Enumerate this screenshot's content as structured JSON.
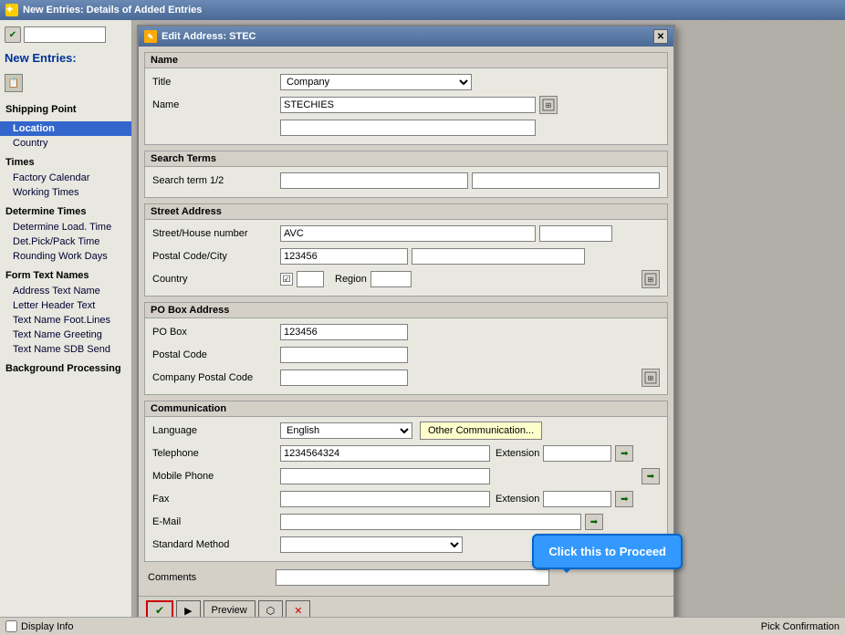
{
  "window": {
    "title": "New Entries: Details of Added Entries",
    "dialog_title": "Edit Address:  STEC"
  },
  "sidebar": {
    "new_entries_label": "New Entries:",
    "sections": [
      {
        "id": "shipping",
        "label": "Shipping Point",
        "items": []
      },
      {
        "id": "location",
        "label": "Location",
        "active": true,
        "items": [
          {
            "id": "country",
            "label": "Country"
          }
        ]
      },
      {
        "id": "times",
        "label": "Times",
        "items": [
          {
            "id": "factory-calendar",
            "label": "Factory Calendar"
          },
          {
            "id": "working-times",
            "label": "Working Times"
          }
        ]
      },
      {
        "id": "determine-times",
        "label": "Determine Times",
        "items": [
          {
            "id": "determine-load",
            "label": "Determine Load. Time"
          },
          {
            "id": "det-pick-pack",
            "label": "Det.Pick/Pack Time"
          },
          {
            "id": "rounding-work",
            "label": "Rounding Work Days"
          }
        ]
      },
      {
        "id": "form-text",
        "label": "Form Text Names",
        "items": [
          {
            "id": "address-text",
            "label": "Address Text Name"
          },
          {
            "id": "letter-header",
            "label": "Letter Header Text"
          },
          {
            "id": "foot-lines",
            "label": "Text Name Foot.Lines"
          },
          {
            "id": "greeting",
            "label": "Text Name Greeting"
          },
          {
            "id": "sdb-send",
            "label": "Text Name SDB Send"
          }
        ]
      },
      {
        "id": "background",
        "label": "Background Processing",
        "items": []
      }
    ]
  },
  "dialog": {
    "title": "Edit Address:  STEC",
    "sections": {
      "name": {
        "header": "Name",
        "title_label": "Title",
        "title_value": "Company",
        "name_label": "Name",
        "name_value": "STECHIES",
        "name_value2": ""
      },
      "search_terms": {
        "header": "Search Terms",
        "label": "Search term 1/2",
        "value1": "",
        "value2": ""
      },
      "street_address": {
        "header": "Street Address",
        "street_label": "Street/House number",
        "street_value": "AVC",
        "house_value": "",
        "postal_label": "Postal Code/City",
        "postal_value": "123456",
        "city_value": "",
        "country_label": "Country",
        "country_checked": true,
        "region_label": "Region",
        "region_value": ""
      },
      "po_box": {
        "header": "PO Box Address",
        "po_box_label": "PO Box",
        "po_box_value": "123456",
        "postal_label": "Postal Code",
        "postal_value": "",
        "company_postal_label": "Company Postal Code",
        "company_postal_value": ""
      },
      "communication": {
        "header": "Communication",
        "language_label": "Language",
        "language_value": "English",
        "other_comm_btn": "Other Communication...",
        "telephone_label": "Telephone",
        "telephone_value": "1234564324",
        "extension_label": "Extension",
        "extension_value": "",
        "mobile_label": "Mobile Phone",
        "mobile_value": "",
        "fax_label": "Fax",
        "fax_value": "",
        "fax_ext_label": "Extension",
        "fax_ext_value": "",
        "email_label": "E-Mail",
        "email_value": "",
        "std_method_label": "Standard Method",
        "std_method_value": ""
      },
      "comments": {
        "header_label": "Comments",
        "value": ""
      }
    }
  },
  "footer": {
    "save_btn": "✔",
    "preview_btn": "Preview",
    "cancel_icon": "✕"
  },
  "callout": {
    "text": "Click this to Proceed"
  },
  "status_bar": {
    "display_info_label": "Display Info",
    "pick_confirmation_label": "Pick Confirmation"
  }
}
